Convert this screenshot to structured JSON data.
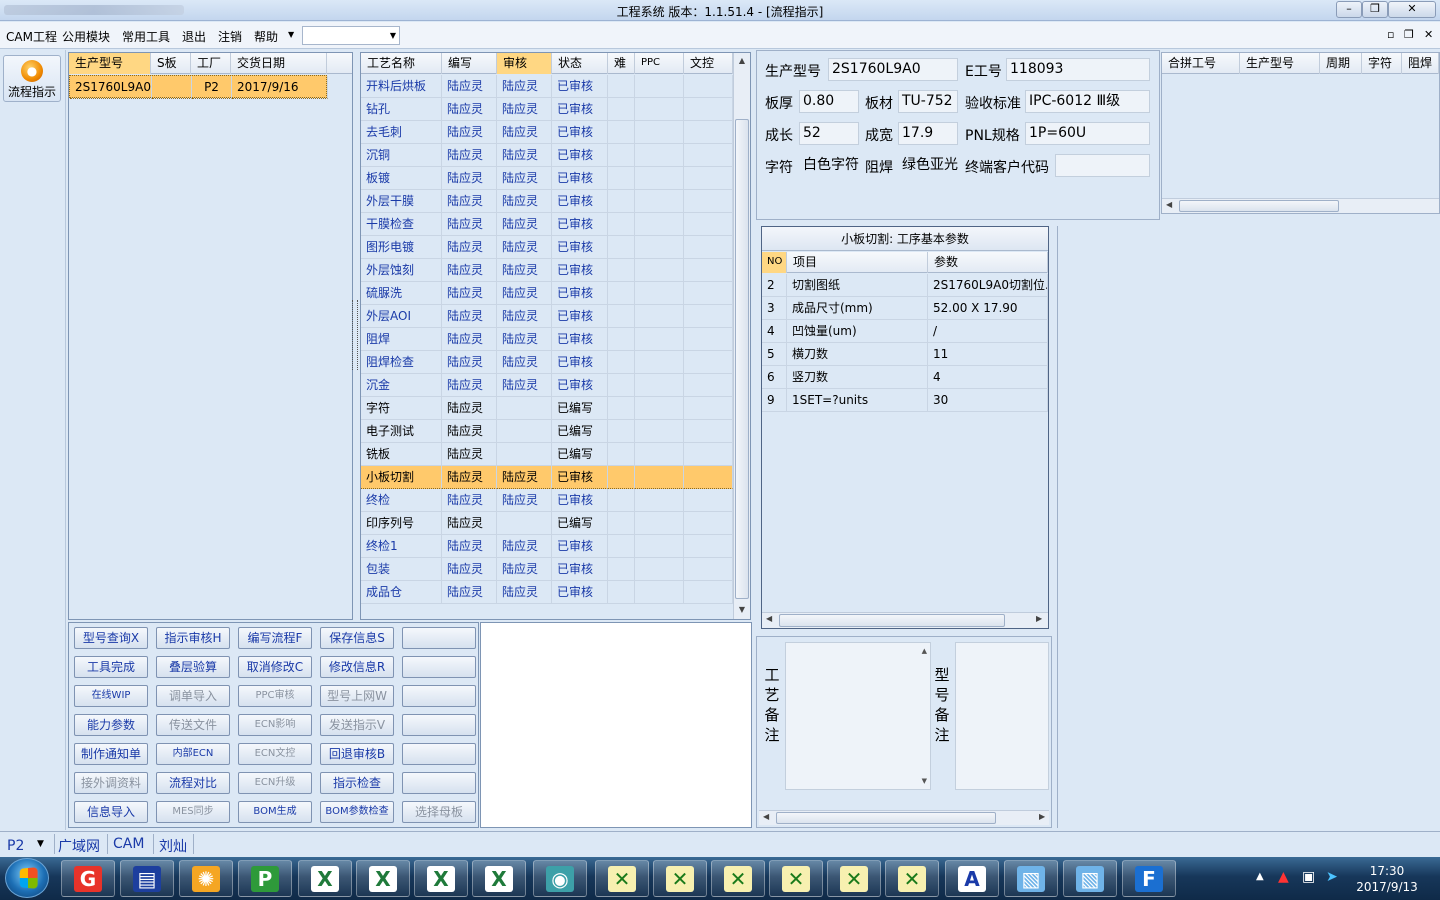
{
  "window": {
    "title": "工程系统    版本：1.1.51.4 - [流程指示]"
  },
  "menu": {
    "items": [
      "CAM工程",
      "公用模块",
      "常用工具",
      "退出",
      "注销",
      "帮助"
    ],
    "combo_value": ""
  },
  "toolbar": {
    "flow_button": "流程指示"
  },
  "left_grid": {
    "headers": [
      "生产型号",
      "S板",
      "工厂",
      "交货日期"
    ],
    "rows": [
      [
        "2S1760L9A0",
        "",
        "P2",
        "2017/9/16"
      ]
    ]
  },
  "process_grid": {
    "headers": [
      "工艺名称",
      "编写",
      "审核",
      "状态",
      "难",
      "PPC",
      "文控"
    ],
    "rows": [
      [
        "开料后烘板",
        "陆应灵",
        "陆应灵",
        "已审核"
      ],
      [
        "钻孔",
        "陆应灵",
        "陆应灵",
        "已审核"
      ],
      [
        "去毛刺",
        "陆应灵",
        "陆应灵",
        "已审核"
      ],
      [
        "沉铜",
        "陆应灵",
        "陆应灵",
        "已审核"
      ],
      [
        "板镀",
        "陆应灵",
        "陆应灵",
        "已审核"
      ],
      [
        "外层干膜",
        "陆应灵",
        "陆应灵",
        "已审核"
      ],
      [
        "干膜检查",
        "陆应灵",
        "陆应灵",
        "已审核"
      ],
      [
        "图形电镀",
        "陆应灵",
        "陆应灵",
        "已审核"
      ],
      [
        "外层蚀刻",
        "陆应灵",
        "陆应灵",
        "已审核"
      ],
      [
        "硫脲洗",
        "陆应灵",
        "陆应灵",
        "已审核"
      ],
      [
        "外层AOI",
        "陆应灵",
        "陆应灵",
        "已审核"
      ],
      [
        "阻焊",
        "陆应灵",
        "陆应灵",
        "已审核"
      ],
      [
        "阻焊检查",
        "陆应灵",
        "陆应灵",
        "已审核"
      ],
      [
        "沉金",
        "陆应灵",
        "陆应灵",
        "已审核"
      ],
      [
        "字符",
        "陆应灵",
        "",
        "已编写"
      ],
      [
        "电子测试",
        "陆应灵",
        "",
        "已编写"
      ],
      [
        "铣板",
        "陆应灵",
        "",
        "已编写"
      ],
      [
        "小板切割",
        "陆应灵",
        "陆应灵",
        "已审核"
      ],
      [
        "终检",
        "陆应灵",
        "陆应灵",
        "已审核"
      ],
      [
        "印序列号",
        "陆应灵",
        "",
        "已编写"
      ],
      [
        "终检1",
        "陆应灵",
        "陆应灵",
        "已审核"
      ],
      [
        "包装",
        "陆应灵",
        "陆应灵",
        "已审核"
      ],
      [
        "成品仓",
        "陆应灵",
        "陆应灵",
        "已审核"
      ]
    ],
    "selected_index": 17
  },
  "buttons": [
    [
      "型号查询X",
      "指示审核H",
      "编写流程F",
      "保存信息S",
      ""
    ],
    [
      "工具完成",
      "叠层验算",
      "取消修改C",
      "修改信息R",
      ""
    ],
    [
      "在线WIP",
      "调单导入",
      "PPC审核",
      "型号上网W",
      ""
    ],
    [
      "能力参数",
      "传送文件",
      "ECN影响",
      "发送指示V",
      ""
    ],
    [
      "制作通知单",
      "内部ECN",
      "ECN文控",
      "回退审核B",
      ""
    ],
    [
      "接外调资料",
      "流程对比",
      "ECN升级",
      "指示检查",
      ""
    ],
    [
      "信息导入",
      "MES同步",
      "BOM生成",
      "BOM参数检查",
      "选择母板"
    ]
  ],
  "info": {
    "model_label": "生产型号",
    "model_value": "2S1760L9A0",
    "e_label": "E工号",
    "e_value": "118093",
    "thick_label": "板厚",
    "thick_value": "0.80",
    "material_label": "板材",
    "material_value": "TU-752",
    "std_label": "验收标准",
    "std_value": "IPC-6012 Ⅲ级",
    "len_label": "成长",
    "len_value": "52",
    "wid_label": "成宽",
    "wid_value": "17.9",
    "pnl_label": "PNL规格",
    "pnl_value": "1P=60U",
    "char_label": "字符",
    "char_value": "白色字符",
    "mask_label": "阻焊",
    "mask_value": "绿色亚光",
    "cust_label": "终端客户代码",
    "cust_value": ""
  },
  "merge_grid": {
    "headers": [
      "合拼工号",
      "生产型号",
      "周期",
      "字符",
      "阻焊"
    ]
  },
  "param": {
    "title": "小板切割: 工序基本参数",
    "headers": [
      "NO",
      "项目",
      "参数"
    ],
    "rows": [
      [
        "2",
        "切割图纸",
        "2S1760L9A0切割位."
      ],
      [
        "3",
        "成品尺寸(mm)",
        "52.00 X 17.90"
      ],
      [
        "4",
        "凹蚀量(um)",
        "/"
      ],
      [
        "5",
        "横刀数",
        "11"
      ],
      [
        "6",
        "竖刀数",
        "4"
      ],
      [
        "9",
        "1SET=?units",
        "30"
      ]
    ]
  },
  "remarks": {
    "process_label": "工艺备注",
    "model_label": "型号备注"
  },
  "status": {
    "factory": "P2",
    "network": "广域网",
    "system": "CAM",
    "user": "刘灿"
  },
  "clock": {
    "time": "17:30",
    "date": "2017/9/13"
  },
  "colors": {
    "accent": "#ffc96b",
    "link_text": "#1a3aa8",
    "panel_bg": "#dce8f5"
  }
}
